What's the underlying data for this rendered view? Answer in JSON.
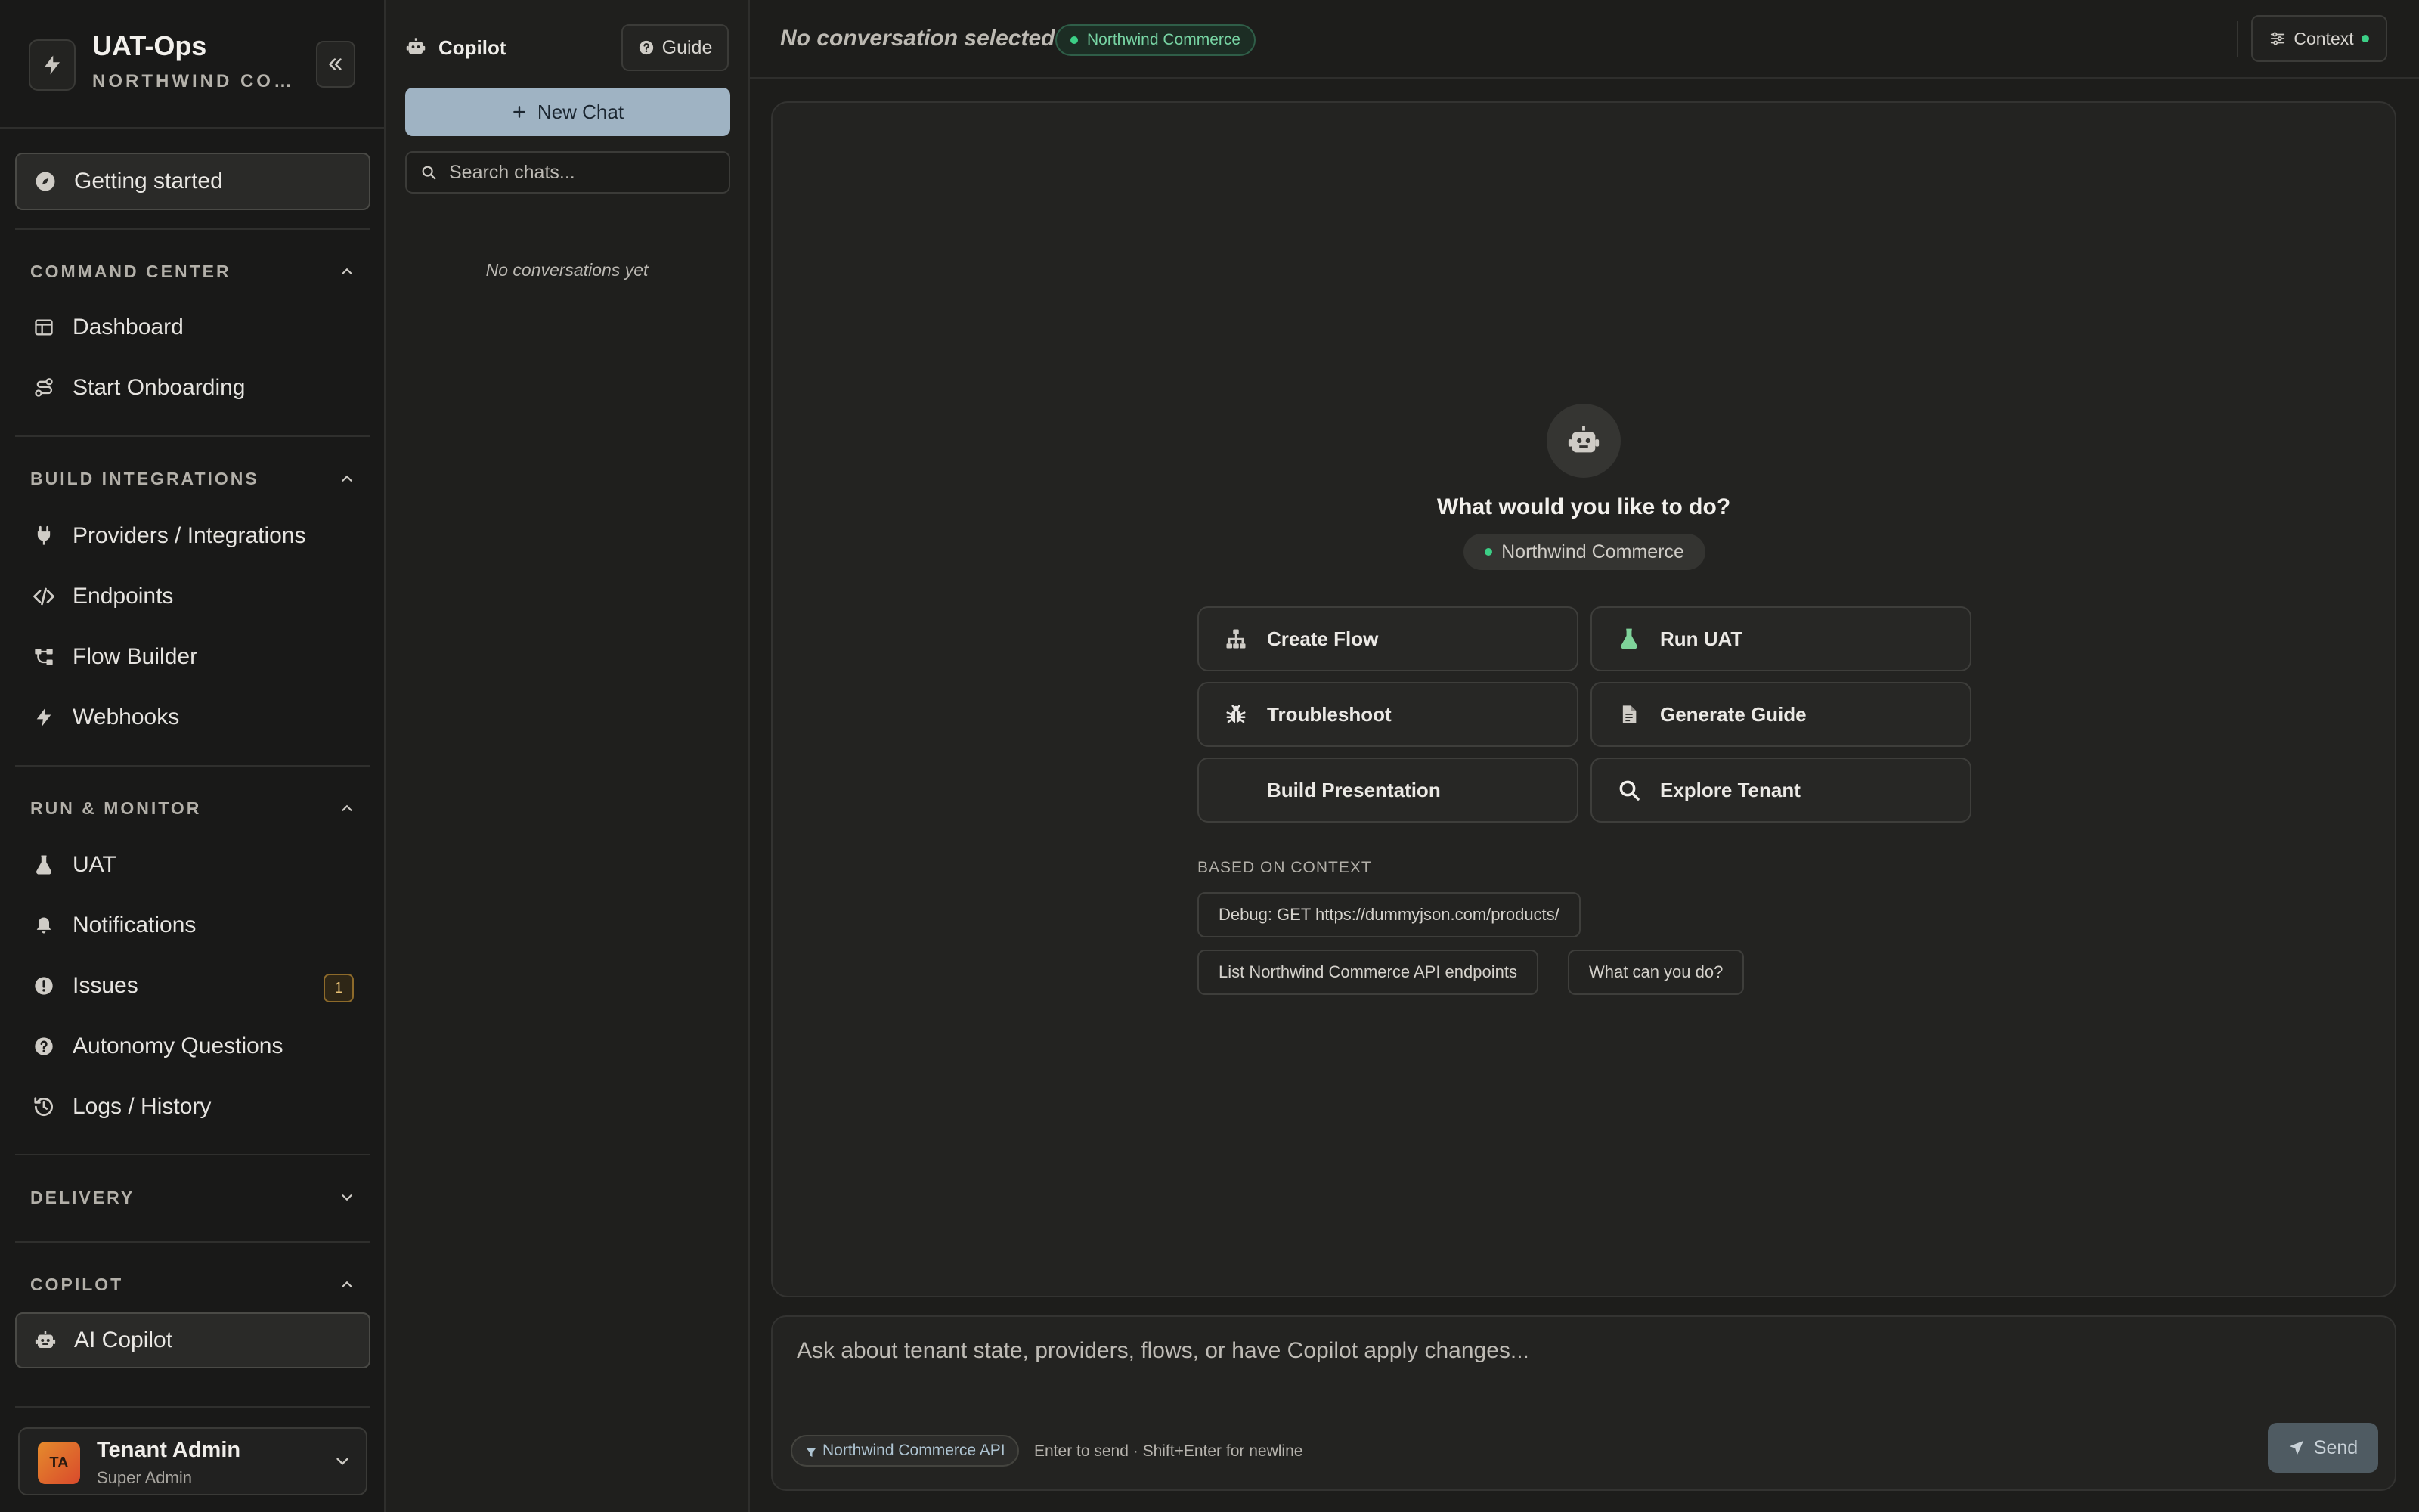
{
  "brand": {
    "title": "UAT-Ops",
    "subtitle": "NORTHWIND COM..."
  },
  "sidebar": {
    "getting_started": "Getting started",
    "sections": {
      "command_center": {
        "title": "COMMAND CENTER",
        "items": [
          {
            "label": "Dashboard",
            "icon": "dashboard-icon"
          },
          {
            "label": "Start Onboarding",
            "icon": "route-icon"
          }
        ]
      },
      "build_integrations": {
        "title": "BUILD INTEGRATIONS",
        "items": [
          {
            "label": "Providers / Integrations",
            "icon": "plug-icon"
          },
          {
            "label": "Endpoints",
            "icon": "code-icon"
          },
          {
            "label": "Flow Builder",
            "icon": "flow-icon"
          },
          {
            "label": "Webhooks",
            "icon": "bolt-icon"
          }
        ]
      },
      "run_monitor": {
        "title": "RUN & MONITOR",
        "items": [
          {
            "label": "UAT",
            "icon": "flask-icon"
          },
          {
            "label": "Notifications",
            "icon": "bell-icon"
          },
          {
            "label": "Issues",
            "icon": "alert-icon",
            "badge": "1"
          },
          {
            "label": "Autonomy Questions",
            "icon": "question-icon"
          },
          {
            "label": "Logs / History",
            "icon": "history-icon"
          }
        ]
      },
      "delivery": {
        "title": "DELIVERY"
      },
      "copilot": {
        "title": "COPILOT",
        "items": [
          {
            "label": "AI Copilot",
            "icon": "robot-icon"
          }
        ]
      }
    },
    "user": {
      "initials": "TA",
      "name": "Tenant Admin",
      "role": "Super Admin"
    }
  },
  "chatlist": {
    "title": "Copilot",
    "guide_label": "Guide",
    "new_chat_label": "New Chat",
    "search_placeholder": "Search chats...",
    "empty_text": "No conversations yet"
  },
  "topbar": {
    "title": "No conversation selected",
    "tenant": "Northwind Commerce",
    "context_label": "Context"
  },
  "main": {
    "hero_title": "What would you like to do?",
    "hero_tenant": "Northwind Commerce",
    "actions": [
      {
        "label": "Create Flow",
        "icon": "hierarchy-icon"
      },
      {
        "label": "Run UAT",
        "icon": "flask-icon"
      },
      {
        "label": "Troubleshoot",
        "icon": "bug-icon"
      },
      {
        "label": "Generate Guide",
        "icon": "document-icon"
      },
      {
        "label": "Build Presentation",
        "icon": ""
      },
      {
        "label": "Explore Tenant",
        "icon": "search-icon"
      }
    ],
    "context_heading": "BASED ON CONTEXT",
    "suggestions": [
      "Debug: GET https://dummyjson.com/products/",
      "List Northwind Commerce API endpoints",
      "What can you do?"
    ]
  },
  "composer": {
    "placeholder": "Ask about tenant state, providers, flows, or have Copilot apply changes...",
    "api_chip": "Northwind Commerce API",
    "hint": "Enter to send · Shift+Enter for newline",
    "send_label": "Send"
  },
  "colors": {
    "accent_green": "#3ccf86",
    "new_chat_bg": "#9fb3c3",
    "badge_amber": "#e7c074"
  }
}
